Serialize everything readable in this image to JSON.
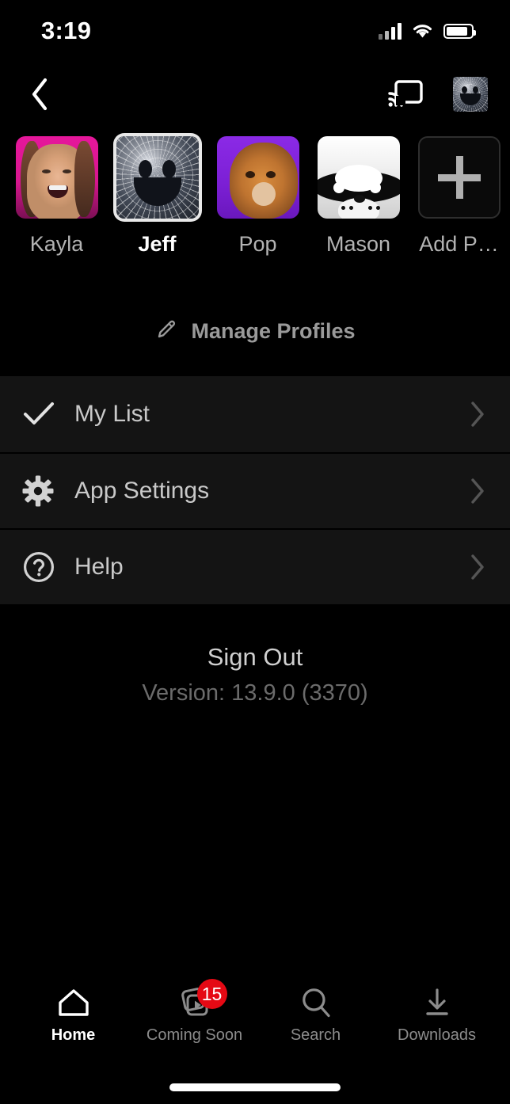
{
  "status_bar": {
    "time": "3:19",
    "cellular_icon": "cellular-bars-icon",
    "wifi_icon": "wifi-icon",
    "battery_icon": "battery-icon",
    "battery_level_pct": 88
  },
  "nav_bar": {
    "back_icon": "back-chevron-icon",
    "cast_icon": "cast-icon",
    "avatar_icon": "profile-avatar-icon"
  },
  "profiles": {
    "items": [
      {
        "name": "Kayla",
        "selected": false,
        "avatar": "kayla-avatar"
      },
      {
        "name": "Jeff",
        "selected": true,
        "avatar": "jeff-avatar"
      },
      {
        "name": "Pop",
        "selected": false,
        "avatar": "pop-avatar"
      },
      {
        "name": "Mason",
        "selected": false,
        "avatar": "mason-avatar"
      },
      {
        "name": "Add P…",
        "selected": false,
        "avatar": "add-profile-plus-icon"
      }
    ]
  },
  "manage_profiles": {
    "label": "Manage Profiles",
    "icon": "pencil-icon"
  },
  "menu": {
    "rows": [
      {
        "label": "My List",
        "icon": "check-icon",
        "chevron": "chevron-right-icon"
      },
      {
        "label": "App Settings",
        "icon": "gear-icon",
        "chevron": "chevron-right-icon"
      },
      {
        "label": "Help",
        "icon": "question-circle-icon",
        "chevron": "chevron-right-icon"
      }
    ]
  },
  "footer": {
    "sign_out": "Sign Out",
    "version": "Version: 13.9.0 (3370)"
  },
  "tab_bar": {
    "tabs": [
      {
        "label": "Home",
        "icon": "home-icon",
        "active": true,
        "badge": ""
      },
      {
        "label": "Coming Soon",
        "icon": "coming-soon-icon",
        "active": false,
        "badge": "15"
      },
      {
        "label": "Search",
        "icon": "search-icon",
        "active": false,
        "badge": ""
      },
      {
        "label": "Downloads",
        "icon": "downloads-icon",
        "active": false,
        "badge": ""
      }
    ]
  },
  "colors": {
    "background": "#000000",
    "menu_background": "#141414",
    "badge_red": "#e50914",
    "text_primary": "#ffffff",
    "text_secondary": "#b3b3b3",
    "text_dim": "#6b6b6b"
  }
}
